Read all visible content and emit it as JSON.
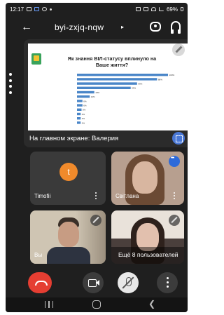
{
  "status_bar": {
    "time": "12:17",
    "battery": "69%"
  },
  "header": {
    "meeting_code": "byi-zxjq-nqw",
    "chevron": "▸"
  },
  "presentation": {
    "slide_title_line1": "Як знання ВІЛ-статусу вплинуло на",
    "slide_title_line2": "Ваше життя?",
    "presenter_label": "На главном экране: Валерия",
    "chart_data": {
      "type": "bar",
      "orientation": "horizontal",
      "title": "Як знання ВІЛ-статусу вплинуло на Ваше життя?",
      "categories": [
        "",
        "",
        "",
        "",
        "",
        "",
        "",
        "",
        "",
        "",
        "",
        ""
      ],
      "values": [
        100,
        88,
        66,
        59,
        19,
        14,
        6,
        6,
        5,
        4,
        4,
        4
      ],
      "value_labels": [
        "100%",
        "88%",
        "66%",
        "59%",
        "19%",
        "14%",
        "6%",
        "6%",
        "5%",
        "4%",
        "4%",
        "4%"
      ],
      "xlim": [
        0,
        100
      ],
      "colors": {
        "bar": "#4a86c8"
      }
    }
  },
  "participants": {
    "tile1": {
      "initial": "t",
      "name": "Timofii"
    },
    "tile2": {
      "name": "Світлана"
    },
    "tile3": {
      "name": "Вы"
    },
    "tile4": {
      "more_text": "Ещё 8 пользователей"
    }
  },
  "icons": {
    "back": "←",
    "nav_back": "❮"
  },
  "colors": {
    "end_call": "#e53e32",
    "speaking": "#2d6ad9",
    "avatar": "#f08a2b"
  }
}
